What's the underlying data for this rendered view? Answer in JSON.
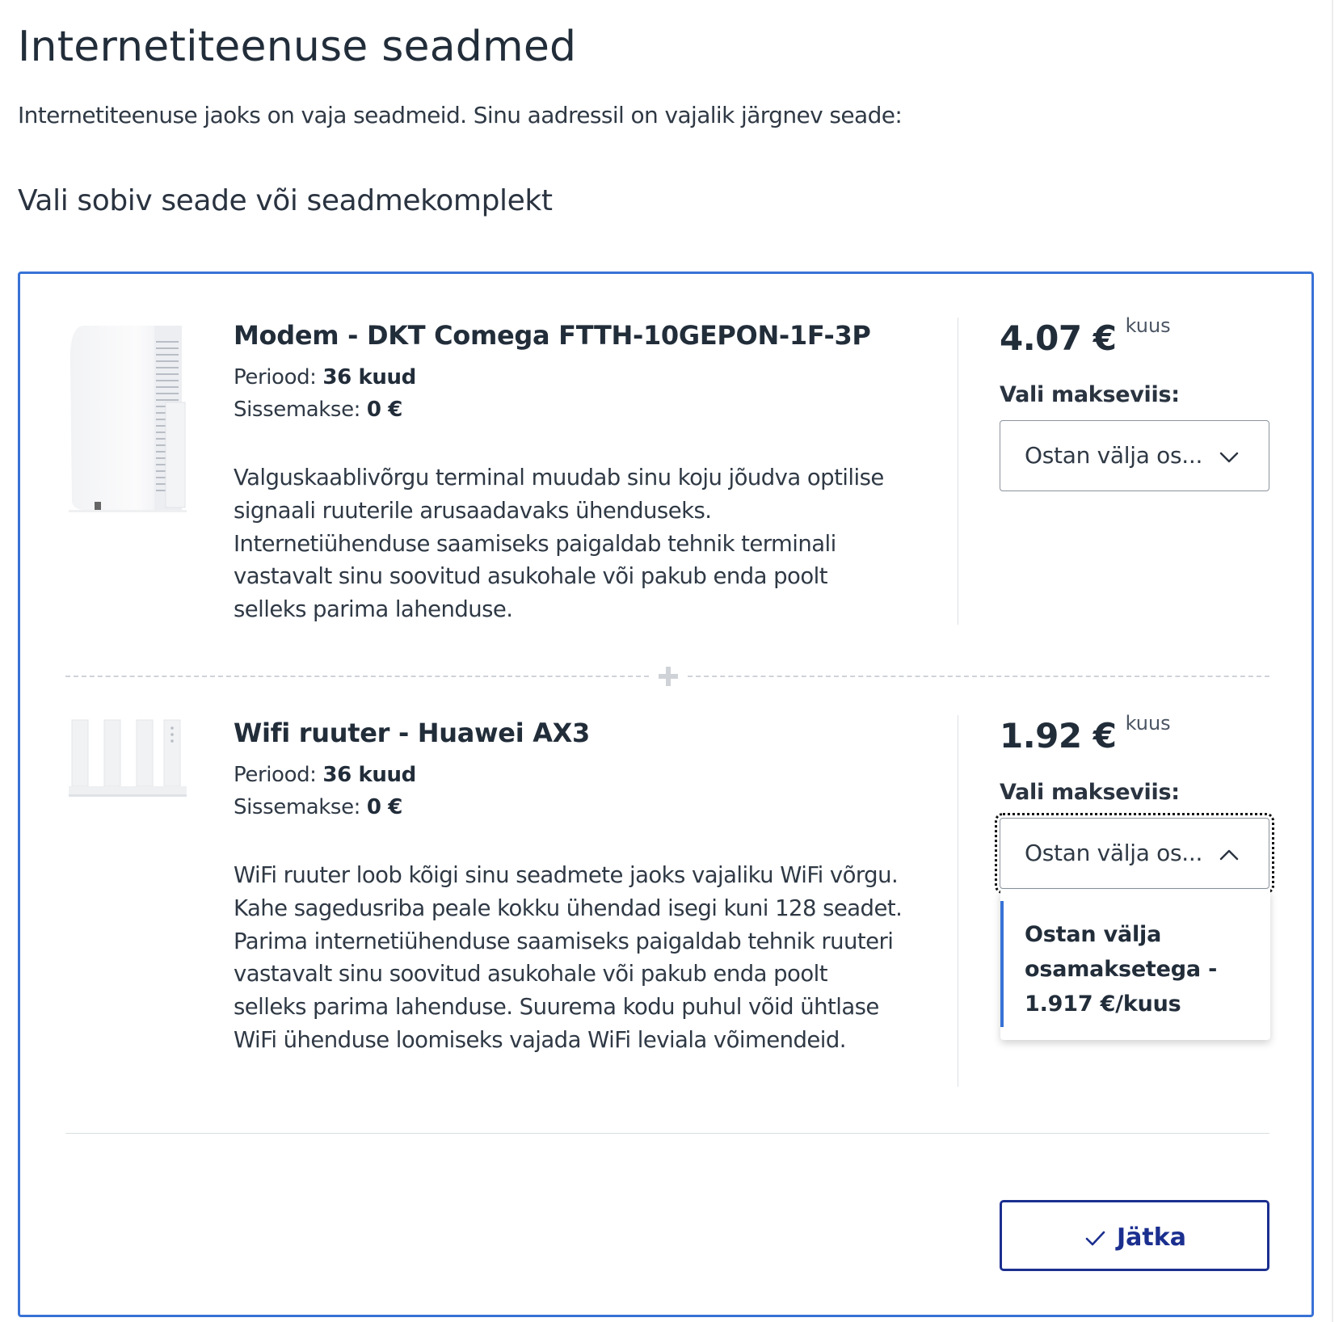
{
  "page": {
    "title": "Internetiteenuse seadmed",
    "intro": "Internetiteenuse jaoks on vaja seadmeid. Sinu aadressil on vajalik järgnev seade:",
    "subtitle": "Vali sobiv seade või seadmekomplekt"
  },
  "devices": [
    {
      "name": "Modem - DKT Comega FTTH-10GEPON-1F-3P",
      "period_label": "Periood:",
      "period_value": "36 kuud",
      "deposit_label": "Sissemakse:",
      "deposit_value": "0 €",
      "description": "Valguskaablivõrgu terminal muudab sinu koju jõudva optilise signaali ruuterile arusaadavaks ühenduseks. Internetiühenduse saamiseks paigaldab tehnik terminali vastavalt sinu soovitud asukohale või pakub enda poolt selleks parima lahenduse.",
      "price": "4.07 €",
      "price_unit": "kuus",
      "pay_label": "Vali makseviis:",
      "select_value": "Ostan välja os...",
      "icon": "chevron-down-icon",
      "image": "modem-image"
    },
    {
      "name": "Wifi ruuter - Huawei AX3",
      "period_label": "Periood:",
      "period_value": "36 kuud",
      "deposit_label": "Sissemakse:",
      "deposit_value": "0 €",
      "description": "WiFi ruuter loob kõigi sinu seadmete jaoks vajaliku WiFi võrgu. Kahe sagedusriba peale kokku ühendad isegi kuni 128 seadet. Parima internetiühenduse saamiseks paigaldab tehnik ruuteri vastavalt sinu soovitud asukohale või pakub enda poolt selleks parima lahenduse. Suurema kodu puhul võid ühtlase WiFi ühenduse loomiseks vajada WiFi leviala võimendeid.",
      "price": "1.92 €",
      "price_unit": "kuus",
      "pay_label": "Vali makseviis:",
      "select_value": "Ostan välja os...",
      "icon": "chevron-up-icon",
      "image": "router-image",
      "dropdown_open": true,
      "options": [
        "Ostan välja osamaksetega - 1.917 €/kuus"
      ]
    }
  ],
  "actions": {
    "continue_label": "Jätka",
    "continue_icon": "check-icon"
  },
  "colors": {
    "accent_blue": "#3872d6",
    "button_navy": "#1b2f8f",
    "text_dark": "#222d3a"
  }
}
